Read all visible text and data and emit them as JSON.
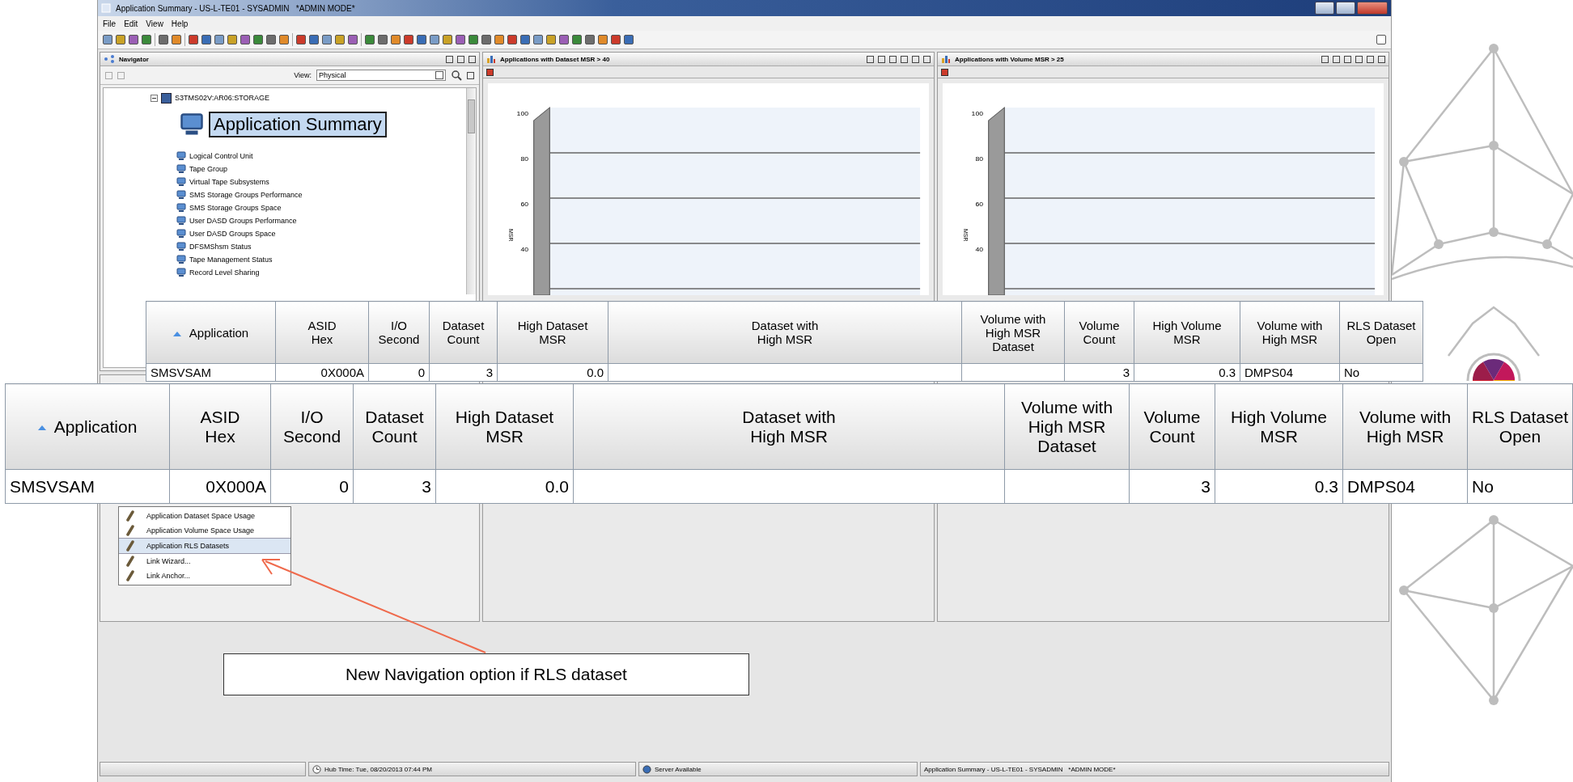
{
  "window": {
    "title": "Application Summary - US-L-TE01 - SYSADMIN   *ADMIN MODE*",
    "menu": [
      "File",
      "Edit",
      "View",
      "Help"
    ]
  },
  "navigator": {
    "title": "Navigator",
    "view_label": "View:",
    "view_value": "Physical",
    "tree": [
      {
        "label": "S3TMS02V:AR06:STORAGE",
        "expanded": true,
        "children": [
          {
            "label": "Application Summary",
            "selected": true
          },
          {
            "label": "Logical Control Unit",
            "selected": false
          },
          {
            "label": "Tape Group",
            "selected": false
          },
          {
            "label": "Virtual Tape Subsystems",
            "selected": false
          },
          {
            "label": "SMS Storage Groups Performance",
            "selected": false
          },
          {
            "label": "SMS Storage Groups Space",
            "selected": false
          },
          {
            "label": "User DASD Groups Performance",
            "selected": false
          },
          {
            "label": "User DASD Groups Space",
            "selected": false
          },
          {
            "label": "DFSMShsm Status",
            "selected": false
          },
          {
            "label": "Tape Management Status",
            "selected": false
          },
          {
            "label": "Record Level Sharing",
            "selected": false
          }
        ]
      }
    ]
  },
  "charts": [
    {
      "title": "Applications with Dataset MSR > 40",
      "y_label": "MSR",
      "y_ticks": [
        "100",
        "80",
        "60",
        "40"
      ]
    },
    {
      "title": "Applications with Volume MSR > 25",
      "y_label": "MSR",
      "y_ticks": [
        "100",
        "80",
        "60",
        "40"
      ]
    }
  ],
  "context_menu": [
    {
      "label": "Application Dataset Space Usage",
      "selected": false
    },
    {
      "label": "Application Volume Space Usage",
      "selected": false
    },
    {
      "label": "Application RLS Datasets",
      "selected": true
    },
    {
      "label": "Link Wizard...",
      "selected": false
    },
    {
      "label": "Link Anchor...",
      "selected": false
    }
  ],
  "tables": [
    {
      "columns": [
        {
          "label": "Application",
          "sorted": true
        },
        {
          "label": "ASID\nHex",
          "sorted": false
        },
        {
          "label": "I/O\nSecond",
          "sorted": false
        },
        {
          "label": "Dataset\nCount",
          "sorted": false
        },
        {
          "label": "High Dataset\nMSR",
          "sorted": false
        },
        {
          "label": "Dataset with\nHigh MSR",
          "sorted": false
        },
        {
          "label": "Volume with\nHigh MSR\nDataset",
          "sorted": false
        },
        {
          "label": "Volume\nCount",
          "sorted": false
        },
        {
          "label": "High Volume\nMSR",
          "sorted": false
        },
        {
          "label": "Volume with\nHigh MSR",
          "sorted": false
        },
        {
          "label": "RLS Dataset\nOpen",
          "sorted": false
        }
      ],
      "rows": [
        [
          "SMSVSAM",
          "0X000A",
          "0",
          "3",
          "0.0",
          "",
          "",
          "3",
          "0.3",
          "DMPS04",
          "No"
        ]
      ]
    },
    {
      "columns": [
        {
          "label": "Application",
          "sorted": true
        },
        {
          "label": "ASID\nHex",
          "sorted": false
        },
        {
          "label": "I/O\nSecond",
          "sorted": false
        },
        {
          "label": "Dataset\nCount",
          "sorted": false
        },
        {
          "label": "High Dataset\nMSR",
          "sorted": false
        },
        {
          "label": "Dataset with\nHigh MSR",
          "sorted": false
        },
        {
          "label": "Volume with\nHigh MSR\nDataset",
          "sorted": false
        },
        {
          "label": "Volume\nCount",
          "sorted": false
        },
        {
          "label": "High Volume\nMSR",
          "sorted": false
        },
        {
          "label": "Volume with\nHigh MSR",
          "sorted": false
        },
        {
          "label": "RLS Dataset\nOpen",
          "sorted": false
        }
      ],
      "rows": [
        [
          "SMSVSAM",
          "0X000A",
          "0",
          "3",
          "0.0",
          "",
          "",
          "3",
          "0.3",
          "DMPS04",
          "No"
        ]
      ]
    }
  ],
  "callout": {
    "text": "New Navigation option if RLS dataset"
  },
  "status_bar": [
    "Hub Time: Tue, 08/20/2013 07:44 PM",
    "Server Available",
    "Application Summary - US-L-TE01 - SYSADMIN   *ADMIN MODE*"
  ]
}
